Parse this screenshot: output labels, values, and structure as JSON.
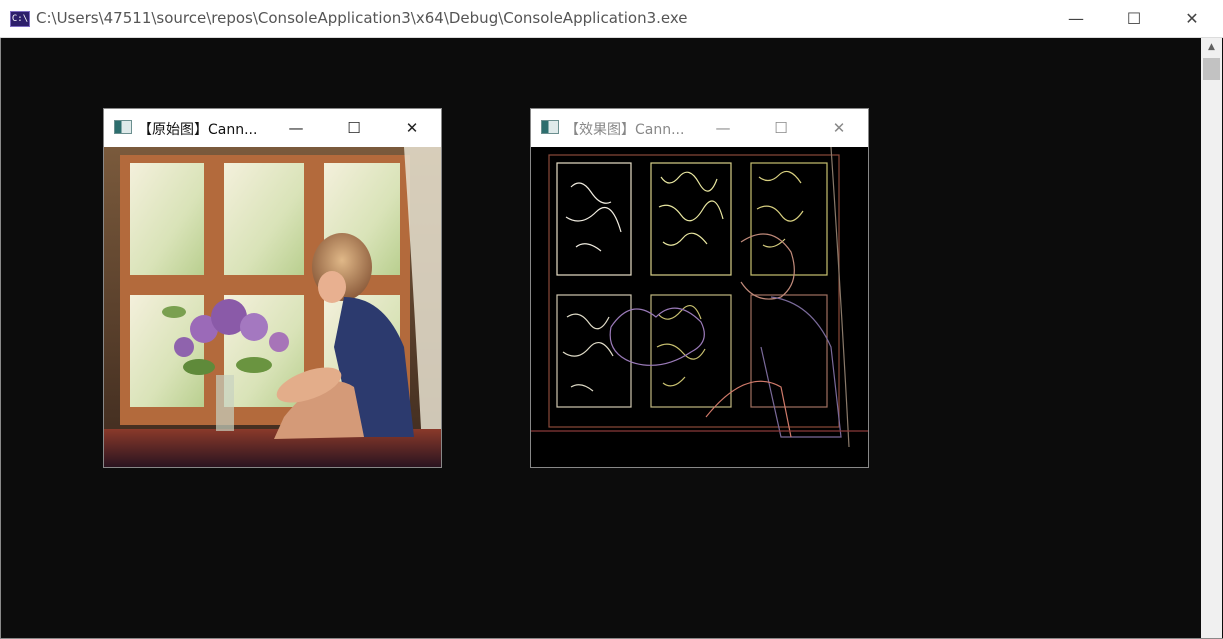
{
  "console": {
    "icon_text": "C:\\",
    "title": "C:\\Users\\47511\\source\\repos\\ConsoleApplication3\\x64\\Debug\\ConsoleApplication3.exe",
    "minimize_glyph": "—",
    "maximize_glyph": "☐",
    "close_glyph": "✕"
  },
  "windows": [
    {
      "title": "【原始图】Cann...",
      "minimize_glyph": "—",
      "maximize_glyph": "☐",
      "close_glyph": "✕",
      "active": true
    },
    {
      "title": "【效果图】Cann...",
      "minimize_glyph": "—",
      "maximize_glyph": "☐",
      "close_glyph": "✕",
      "active": false
    }
  ],
  "scrollbar": {
    "up_glyph": "▲"
  },
  "colors": {
    "console_bg": "#0c0c0c",
    "titlebar_bg": "#ffffff",
    "inactive_title": "#888888"
  }
}
